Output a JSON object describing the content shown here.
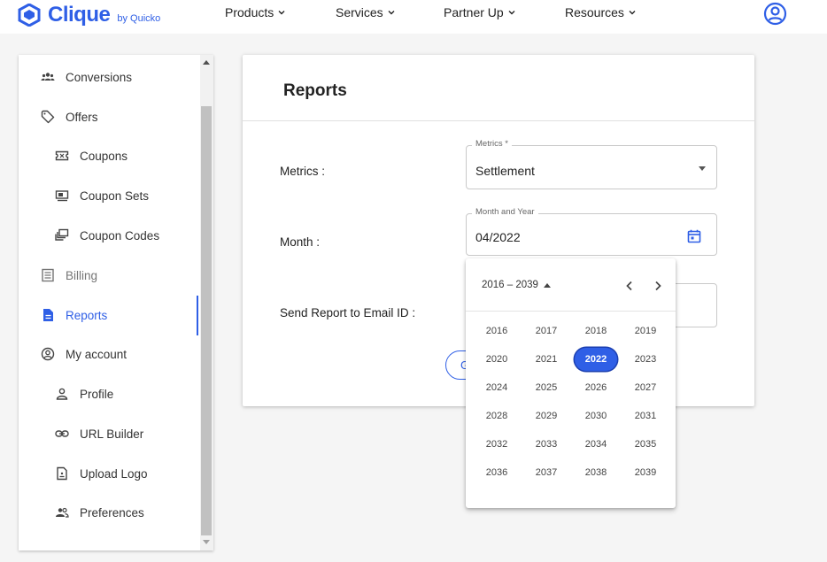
{
  "brand": {
    "name": "Clique",
    "by": "by Quicko",
    "color": "#2f5fe6"
  },
  "nav": {
    "items": [
      {
        "label": "Products"
      },
      {
        "label": "Services"
      },
      {
        "label": "Partner Up"
      },
      {
        "label": "Resources"
      }
    ],
    "account_icon": "account-circle-icon"
  },
  "sidebar": {
    "items": [
      {
        "label": "Conversions",
        "icon": "group-icon",
        "level": "top"
      },
      {
        "label": "Offers",
        "icon": "tag-icon",
        "level": "top"
      },
      {
        "label": "Coupons",
        "icon": "ticket-icon",
        "level": "sub"
      },
      {
        "label": "Coupon Sets",
        "icon": "coupon-set-icon",
        "level": "sub"
      },
      {
        "label": "Coupon Codes",
        "icon": "coupon-codes-icon",
        "level": "sub"
      },
      {
        "label": "Billing",
        "icon": "list-icon",
        "level": "top",
        "muted": true
      },
      {
        "label": "Reports",
        "icon": "document-icon",
        "level": "top",
        "active": true
      },
      {
        "label": "My account",
        "icon": "account-circle-icon",
        "level": "top"
      },
      {
        "label": "Profile",
        "icon": "person-icon",
        "level": "sub"
      },
      {
        "label": "URL Builder",
        "icon": "link-icon",
        "level": "sub"
      },
      {
        "label": "Upload Logo",
        "icon": "file-icon",
        "level": "sub"
      },
      {
        "label": "Preferences",
        "icon": "people-icon",
        "level": "sub"
      }
    ]
  },
  "reports": {
    "title": "Reports",
    "metrics": {
      "row_label": "Metrics :",
      "field_label": "Metrics *",
      "value": "Settlement"
    },
    "month": {
      "row_label": "Month :",
      "field_label": "Month and Year",
      "value": "04/2022"
    },
    "email": {
      "row_label": "Send Report to Email ID :"
    },
    "generate_button": "G"
  },
  "picker": {
    "range": "2016 – 2039",
    "years": [
      "2016",
      "2017",
      "2018",
      "2019",
      "2020",
      "2021",
      "2022",
      "2023",
      "2024",
      "2025",
      "2026",
      "2027",
      "2028",
      "2029",
      "2030",
      "2031",
      "2032",
      "2033",
      "2034",
      "2035",
      "2036",
      "2037",
      "2038",
      "2039"
    ],
    "selected": "2022"
  }
}
